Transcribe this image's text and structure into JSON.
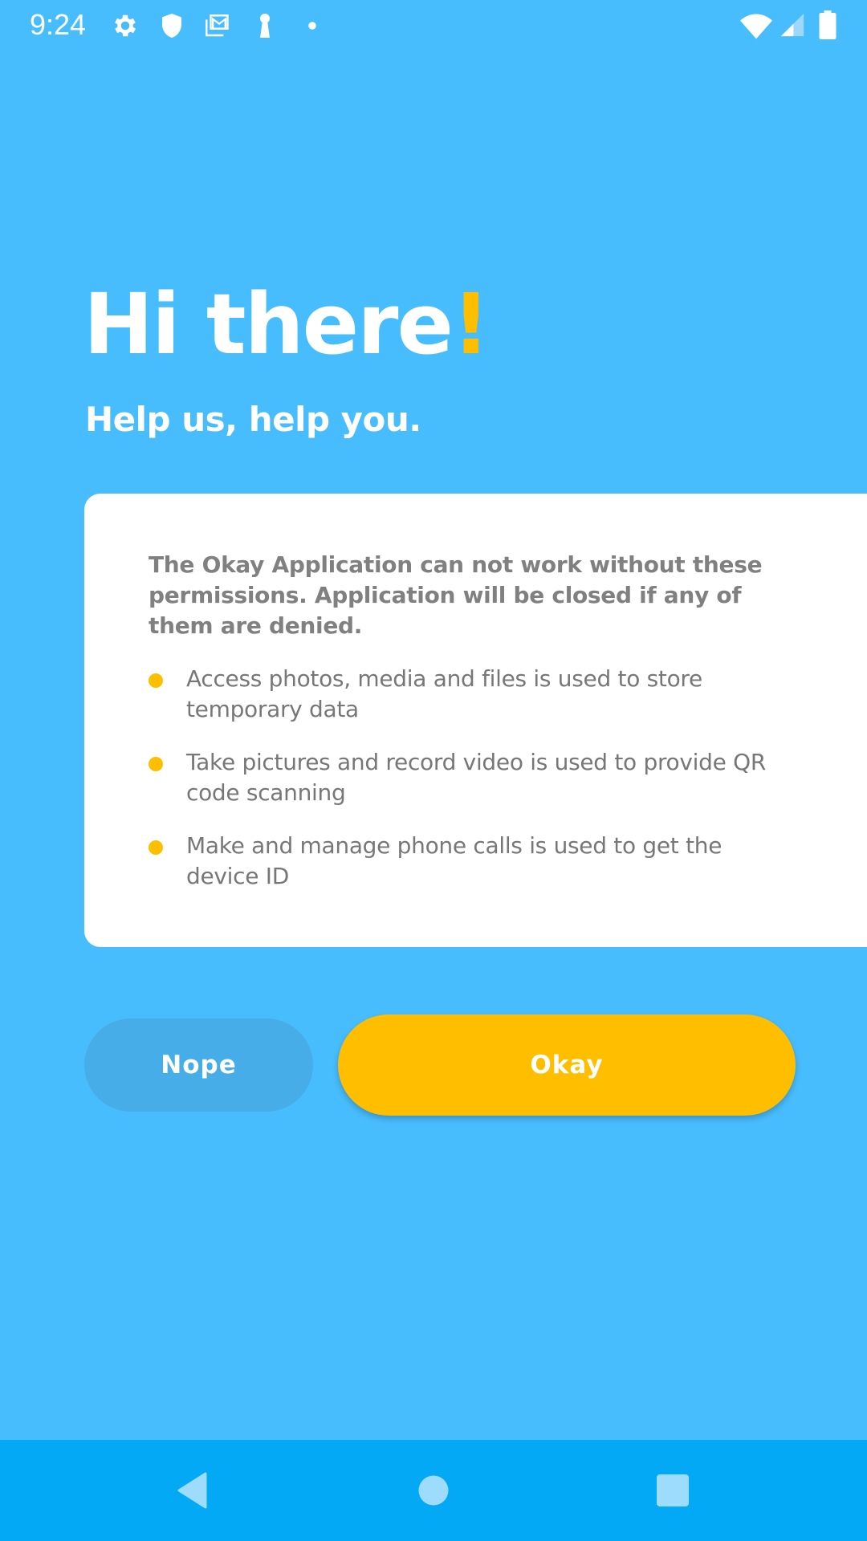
{
  "status_bar": {
    "time": "9:24",
    "left_icons": [
      "gear-icon",
      "shield-icon",
      "gmail-icon",
      "keyhole-icon",
      "dot-icon"
    ],
    "right_icons": [
      "wifi-icon",
      "signal-icon",
      "battery-icon"
    ]
  },
  "header": {
    "title": "Hi there",
    "title_accent": "!",
    "subtitle": "Help us, help you."
  },
  "card": {
    "intro": "The Okay Application can not work without these permissions. Application will be closed if any of them are denied.",
    "permissions": [
      {
        "text": "Access photos, media and files is used to store temporary data"
      },
      {
        "text": "Take pictures and record video is used to provide QR code scanning"
      },
      {
        "text": "Make and manage phone calls is used to get the device ID"
      }
    ]
  },
  "actions": {
    "nope_label": "Nope",
    "okay_label": "Okay"
  },
  "nav_bar": {
    "buttons": [
      "back",
      "home",
      "recents"
    ]
  },
  "colors": {
    "background": "#48BDFE",
    "accent": "#FFBE00",
    "nope_button": "#47ADE8",
    "nav_bar": "#03A9F5",
    "text_gray": "#808080"
  }
}
